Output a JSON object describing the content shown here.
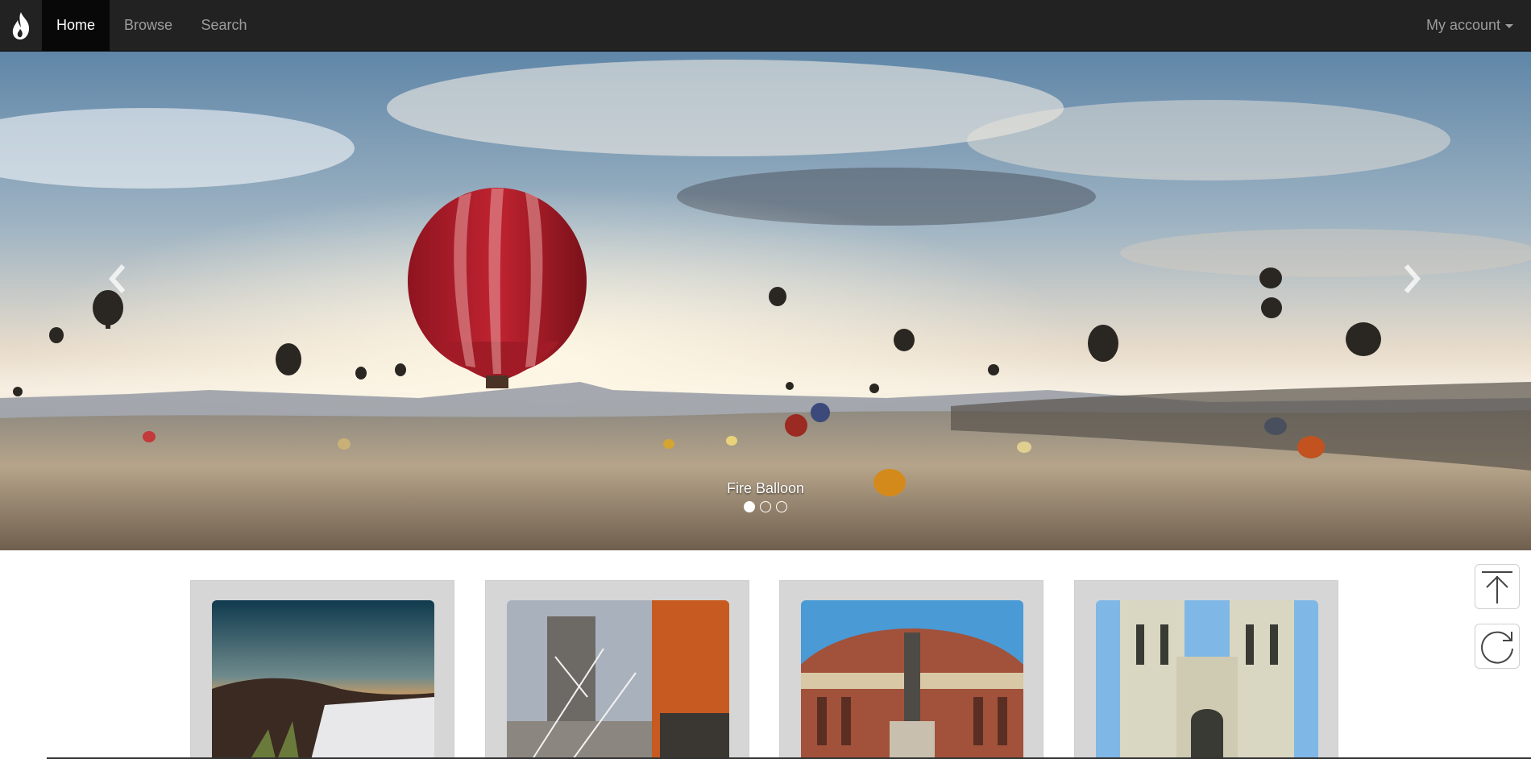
{
  "navbar": {
    "brand_icon": "flame-icon",
    "items": [
      {
        "label": "Home",
        "active": true
      },
      {
        "label": "Browse",
        "active": false
      },
      {
        "label": "Search",
        "active": false
      }
    ],
    "account_label": "My account"
  },
  "carousel": {
    "caption": "Fire Balloon",
    "slide_count": 3,
    "active_slide": 1,
    "prev_icon": "chevron-left-icon",
    "next_icon": "chevron-right-icon"
  },
  "gallery": {
    "cards": [
      {
        "subject": "coastal-village-dusk"
      },
      {
        "subject": "snowy-buildings"
      },
      {
        "subject": "royal-albert-hall"
      },
      {
        "subject": "westminster-abbey"
      }
    ]
  },
  "side_buttons": {
    "top_icon": "arrow-up-icon",
    "reload_icon": "refresh-icon"
  },
  "colors": {
    "navbar_bg": "#222222",
    "nav_active_bg": "#080808",
    "nav_text": "#9d9d9d",
    "card_bg": "#d6d6d6"
  }
}
